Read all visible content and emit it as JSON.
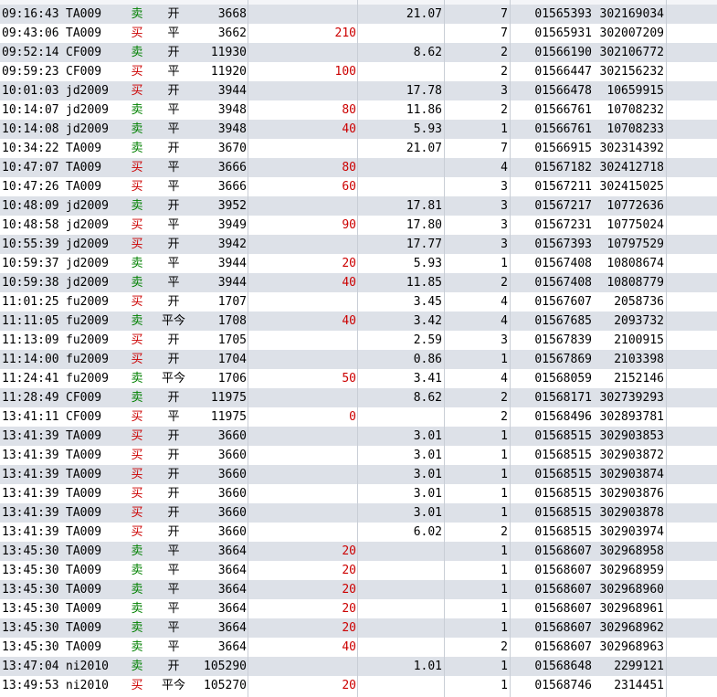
{
  "table": {
    "rows": [
      {
        "time": "09:16:43",
        "symbol": "TA009",
        "side": "sell",
        "side_label": "卖",
        "action": "开",
        "price": "3668",
        "volume": "",
        "fee": "21.07",
        "count": "7",
        "id_a": "01565393",
        "id_b": "302169034"
      },
      {
        "time": "09:43:06",
        "symbol": "TA009",
        "side": "buy",
        "side_label": "买",
        "action": "平",
        "price": "3662",
        "volume": "210",
        "fee": "",
        "count": "7",
        "id_a": "01565931",
        "id_b": "302007209"
      },
      {
        "time": "09:52:14",
        "symbol": "CF009",
        "side": "sell",
        "side_label": "卖",
        "action": "开",
        "price": "11930",
        "volume": "",
        "fee": "8.62",
        "count": "2",
        "id_a": "01566190",
        "id_b": "302106772"
      },
      {
        "time": "09:59:23",
        "symbol": "CF009",
        "side": "buy",
        "side_label": "买",
        "action": "平",
        "price": "11920",
        "volume": "100",
        "fee": "",
        "count": "2",
        "id_a": "01566447",
        "id_b": "302156232"
      },
      {
        "time": "10:01:03",
        "symbol": "jd2009",
        "side": "buy",
        "side_label": "买",
        "action": "开",
        "price": "3944",
        "volume": "",
        "fee": "17.78",
        "count": "3",
        "id_a": "01566478",
        "id_b": "10659915"
      },
      {
        "time": "10:14:07",
        "symbol": "jd2009",
        "side": "sell",
        "side_label": "卖",
        "action": "平",
        "price": "3948",
        "volume": "80",
        "fee": "11.86",
        "count": "2",
        "id_a": "01566761",
        "id_b": "10708232"
      },
      {
        "time": "10:14:08",
        "symbol": "jd2009",
        "side": "sell",
        "side_label": "卖",
        "action": "平",
        "price": "3948",
        "volume": "40",
        "fee": "5.93",
        "count": "1",
        "id_a": "01566761",
        "id_b": "10708233"
      },
      {
        "time": "10:34:22",
        "symbol": "TA009",
        "side": "sell",
        "side_label": "卖",
        "action": "开",
        "price": "3670",
        "volume": "",
        "fee": "21.07",
        "count": "7",
        "id_a": "01566915",
        "id_b": "302314392"
      },
      {
        "time": "10:47:07",
        "symbol": "TA009",
        "side": "buy",
        "side_label": "买",
        "action": "平",
        "price": "3666",
        "volume": "80",
        "fee": "",
        "count": "4",
        "id_a": "01567182",
        "id_b": "302412718"
      },
      {
        "time": "10:47:26",
        "symbol": "TA009",
        "side": "buy",
        "side_label": "买",
        "action": "平",
        "price": "3666",
        "volume": "60",
        "fee": "",
        "count": "3",
        "id_a": "01567211",
        "id_b": "302415025"
      },
      {
        "time": "10:48:09",
        "symbol": "jd2009",
        "side": "sell",
        "side_label": "卖",
        "action": "开",
        "price": "3952",
        "volume": "",
        "fee": "17.81",
        "count": "3",
        "id_a": "01567217",
        "id_b": "10772636"
      },
      {
        "time": "10:48:58",
        "symbol": "jd2009",
        "side": "buy",
        "side_label": "买",
        "action": "平",
        "price": "3949",
        "volume": "90",
        "fee": "17.80",
        "count": "3",
        "id_a": "01567231",
        "id_b": "10775024"
      },
      {
        "time": "10:55:39",
        "symbol": "jd2009",
        "side": "buy",
        "side_label": "买",
        "action": "开",
        "price": "3942",
        "volume": "",
        "fee": "17.77",
        "count": "3",
        "id_a": "01567393",
        "id_b": "10797529"
      },
      {
        "time": "10:59:37",
        "symbol": "jd2009",
        "side": "sell",
        "side_label": "卖",
        "action": "平",
        "price": "3944",
        "volume": "20",
        "fee": "5.93",
        "count": "1",
        "id_a": "01567408",
        "id_b": "10808674"
      },
      {
        "time": "10:59:38",
        "symbol": "jd2009",
        "side": "sell",
        "side_label": "卖",
        "action": "平",
        "price": "3944",
        "volume": "40",
        "fee": "11.85",
        "count": "2",
        "id_a": "01567408",
        "id_b": "10808779"
      },
      {
        "time": "11:01:25",
        "symbol": "fu2009",
        "side": "buy",
        "side_label": "买",
        "action": "开",
        "price": "1707",
        "volume": "",
        "fee": "3.45",
        "count": "4",
        "id_a": "01567607",
        "id_b": "2058736"
      },
      {
        "time": "11:11:05",
        "symbol": "fu2009",
        "side": "sell",
        "side_label": "卖",
        "action": "平今",
        "price": "1708",
        "volume": "40",
        "fee": "3.42",
        "count": "4",
        "id_a": "01567685",
        "id_b": "2093732"
      },
      {
        "time": "11:13:09",
        "symbol": "fu2009",
        "side": "buy",
        "side_label": "买",
        "action": "开",
        "price": "1705",
        "volume": "",
        "fee": "2.59",
        "count": "3",
        "id_a": "01567839",
        "id_b": "2100915"
      },
      {
        "time": "11:14:00",
        "symbol": "fu2009",
        "side": "buy",
        "side_label": "买",
        "action": "开",
        "price": "1704",
        "volume": "",
        "fee": "0.86",
        "count": "1",
        "id_a": "01567869",
        "id_b": "2103398"
      },
      {
        "time": "11:24:41",
        "symbol": "fu2009",
        "side": "sell",
        "side_label": "卖",
        "action": "平今",
        "price": "1706",
        "volume": "50",
        "fee": "3.41",
        "count": "4",
        "id_a": "01568059",
        "id_b": "2152146"
      },
      {
        "time": "11:28:49",
        "symbol": "CF009",
        "side": "sell",
        "side_label": "卖",
        "action": "开",
        "price": "11975",
        "volume": "",
        "fee": "8.62",
        "count": "2",
        "id_a": "01568171",
        "id_b": "302739293"
      },
      {
        "time": "13:41:11",
        "symbol": "CF009",
        "side": "buy",
        "side_label": "买",
        "action": "平",
        "price": "11975",
        "volume": "0",
        "fee": "",
        "count": "2",
        "id_a": "01568496",
        "id_b": "302893781"
      },
      {
        "time": "13:41:39",
        "symbol": "TA009",
        "side": "buy",
        "side_label": "买",
        "action": "开",
        "price": "3660",
        "volume": "",
        "fee": "3.01",
        "count": "1",
        "id_a": "01568515",
        "id_b": "302903853"
      },
      {
        "time": "13:41:39",
        "symbol": "TA009",
        "side": "buy",
        "side_label": "买",
        "action": "开",
        "price": "3660",
        "volume": "",
        "fee": "3.01",
        "count": "1",
        "id_a": "01568515",
        "id_b": "302903872"
      },
      {
        "time": "13:41:39",
        "symbol": "TA009",
        "side": "buy",
        "side_label": "买",
        "action": "开",
        "price": "3660",
        "volume": "",
        "fee": "3.01",
        "count": "1",
        "id_a": "01568515",
        "id_b": "302903874"
      },
      {
        "time": "13:41:39",
        "symbol": "TA009",
        "side": "buy",
        "side_label": "买",
        "action": "开",
        "price": "3660",
        "volume": "",
        "fee": "3.01",
        "count": "1",
        "id_a": "01568515",
        "id_b": "302903876"
      },
      {
        "time": "13:41:39",
        "symbol": "TA009",
        "side": "buy",
        "side_label": "买",
        "action": "开",
        "price": "3660",
        "volume": "",
        "fee": "3.01",
        "count": "1",
        "id_a": "01568515",
        "id_b": "302903878"
      },
      {
        "time": "13:41:39",
        "symbol": "TA009",
        "side": "buy",
        "side_label": "买",
        "action": "开",
        "price": "3660",
        "volume": "",
        "fee": "6.02",
        "count": "2",
        "id_a": "01568515",
        "id_b": "302903974"
      },
      {
        "time": "13:45:30",
        "symbol": "TA009",
        "side": "sell",
        "side_label": "卖",
        "action": "平",
        "price": "3664",
        "volume": "20",
        "fee": "",
        "count": "1",
        "id_a": "01568607",
        "id_b": "302968958"
      },
      {
        "time": "13:45:30",
        "symbol": "TA009",
        "side": "sell",
        "side_label": "卖",
        "action": "平",
        "price": "3664",
        "volume": "20",
        "fee": "",
        "count": "1",
        "id_a": "01568607",
        "id_b": "302968959"
      },
      {
        "time": "13:45:30",
        "symbol": "TA009",
        "side": "sell",
        "side_label": "卖",
        "action": "平",
        "price": "3664",
        "volume": "20",
        "fee": "",
        "count": "1",
        "id_a": "01568607",
        "id_b": "302968960"
      },
      {
        "time": "13:45:30",
        "symbol": "TA009",
        "side": "sell",
        "side_label": "卖",
        "action": "平",
        "price": "3664",
        "volume": "20",
        "fee": "",
        "count": "1",
        "id_a": "01568607",
        "id_b": "302968961"
      },
      {
        "time": "13:45:30",
        "symbol": "TA009",
        "side": "sell",
        "side_label": "卖",
        "action": "平",
        "price": "3664",
        "volume": "20",
        "fee": "",
        "count": "1",
        "id_a": "01568607",
        "id_b": "302968962"
      },
      {
        "time": "13:45:30",
        "symbol": "TA009",
        "side": "sell",
        "side_label": "卖",
        "action": "平",
        "price": "3664",
        "volume": "40",
        "fee": "",
        "count": "2",
        "id_a": "01568607",
        "id_b": "302968963"
      },
      {
        "time": "13:47:04",
        "symbol": "ni2010",
        "side": "sell",
        "side_label": "卖",
        "action": "开",
        "price": "105290",
        "volume": "",
        "fee": "1.01",
        "count": "1",
        "id_a": "01568648",
        "id_b": "2299121"
      },
      {
        "time": "13:49:53",
        "symbol": "ni2010",
        "side": "buy",
        "side_label": "买",
        "action": "平今",
        "price": "105270",
        "volume": "20",
        "fee": "",
        "count": "1",
        "id_a": "01568746",
        "id_b": "2314451"
      }
    ]
  },
  "colors": {
    "buy": "#cc0000",
    "sell": "#008000",
    "row_alt": "#dde1e8",
    "row_plain": "#ffffff",
    "grid_line": "#c9ced6"
  }
}
